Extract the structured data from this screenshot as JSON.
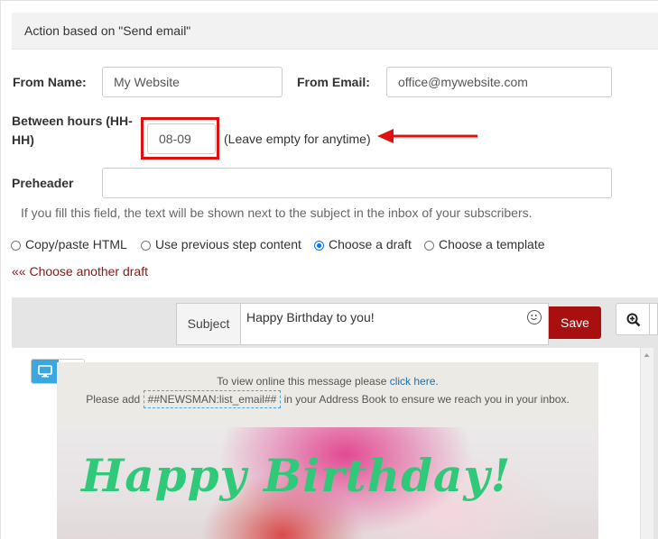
{
  "header": {
    "title": "Action based on \"Send email\""
  },
  "form": {
    "from_name_label": "From Name:",
    "from_name_value": "My Website",
    "from_email_label": "From Email:",
    "from_email_value": "office@mywebsite.com",
    "between_hours_label_1": "Between hours (HH-",
    "between_hours_label_2": "HH)",
    "between_hours_value": "08-09",
    "between_hours_hint": "(Leave empty for anytime)",
    "preheader_label": "Preheader",
    "preheader_value": "",
    "preheader_help": "If you fill this field, the text will be shown next to the subject in the inbox of your subscribers."
  },
  "content_source": {
    "options": [
      {
        "label": "Copy/paste HTML",
        "selected": false
      },
      {
        "label": "Use previous step content",
        "selected": false
      },
      {
        "label": "Choose a draft",
        "selected": true
      },
      {
        "label": "Choose a template",
        "selected": false
      }
    ],
    "back_link": "«« Choose another draft"
  },
  "editor": {
    "subject_label": "Subject",
    "subject_value": "Happy Birthday to you!",
    "save_label": "Save",
    "accent_color": "#a80f0f",
    "device_active": "desktop",
    "email": {
      "view_online_text": "To view online this message please ",
      "view_online_link": "click here.",
      "add_text_before": "Please add ",
      "address_tag": "##NEWSMAN:list_email##",
      "add_text_after": " in your Address Book to ensure we reach you in your inbox.",
      "hero_title": "Happy Birthday!"
    }
  },
  "icons": {
    "arrow": "red-arrow-left-icon",
    "emoji": "smiley-icon",
    "zoom": "zoom-in-icon",
    "desktop": "desktop-icon",
    "mobile": "mobile-icon"
  }
}
